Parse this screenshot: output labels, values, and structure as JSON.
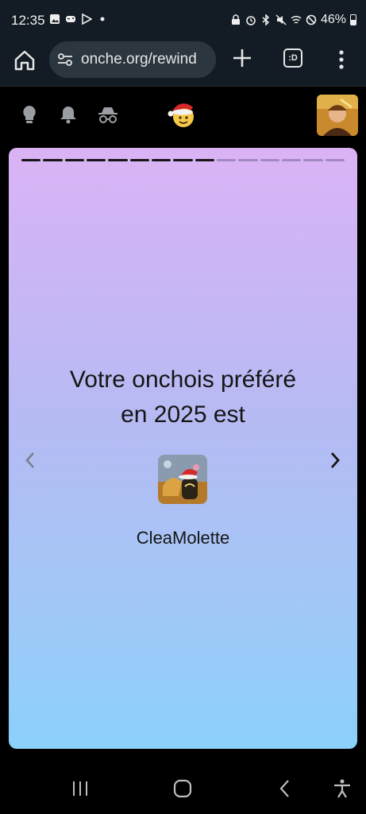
{
  "status_bar": {
    "time": "12:35",
    "battery": "46%",
    "left_icons": [
      "image-icon",
      "game-controller-icon",
      "play-store-icon",
      "dot-icon"
    ],
    "right_icons": [
      "lock-icon",
      "alarm-icon",
      "bluetooth-icon",
      "mute-icon",
      "wifi-icon",
      "do-not-disturb-icon",
      "battery-icon"
    ]
  },
  "browser": {
    "url": "onche.org/rewind",
    "tabs_label": ":D",
    "icons": [
      "home-icon",
      "site-settings-icon",
      "new-tab-icon",
      "tabs-icon",
      "menu-icon"
    ]
  },
  "site_header": {
    "icons": [
      "lightbulb-icon",
      "bell-icon",
      "incognito-icon",
      "santa-hat-emoji-logo",
      "user-avatar"
    ]
  },
  "story": {
    "total_segments": 15,
    "active_segments": 9,
    "title": "Votre onchois préféré en 2025 est",
    "favorite_name": "CleaMolette"
  },
  "colors": {
    "chrome_bg": "#131c24",
    "url_bg": "#2b363f",
    "gradient_top": "#dbb3f5",
    "gradient_bottom": "#8bd0fb"
  }
}
